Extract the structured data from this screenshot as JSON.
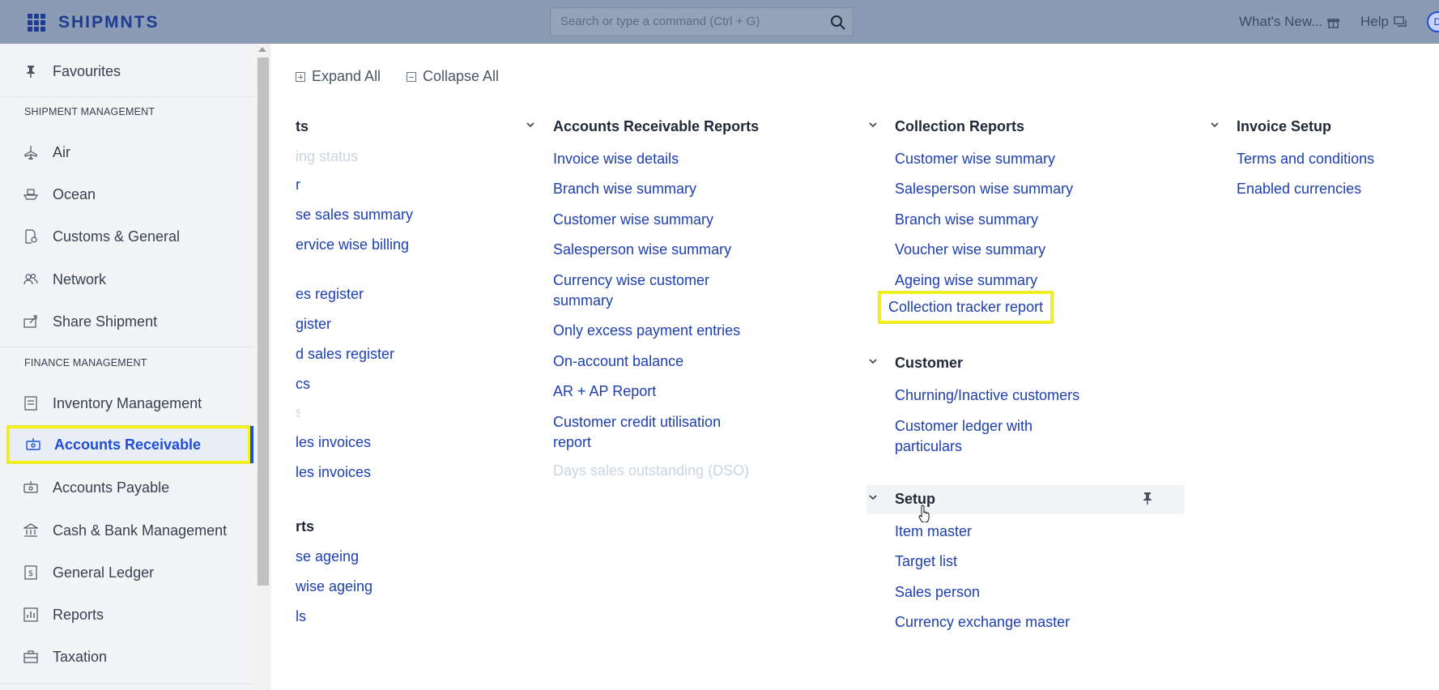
{
  "header": {
    "brand": "SHIPMNTS",
    "search_placeholder": "Search or type a command (Ctrl + G)",
    "whats_new": "What's New...",
    "help": "Help",
    "avatar_initial": "D",
    "brand_color": "#1d3b8f",
    "bar_color": "#8c9bb4"
  },
  "sidebar": {
    "favourites": "Favourites",
    "shipment_heading": "SHIPMENT MANAGEMENT",
    "shipment_items": [
      {
        "label": "Air",
        "icon": "plane-icon"
      },
      {
        "label": "Ocean",
        "icon": "ship-icon"
      },
      {
        "label": "Customs & General",
        "icon": "customs-icon"
      },
      {
        "label": "Network",
        "icon": "users-icon"
      },
      {
        "label": "Share Shipment",
        "icon": "share-icon"
      }
    ],
    "finance_heading": "FINANCE MANAGEMENT",
    "finance_items": [
      {
        "label": "Inventory Management",
        "icon": "inventory-icon"
      },
      {
        "label": "Accounts Receivable",
        "icon": "receivable-icon",
        "active": true
      },
      {
        "label": "Accounts Payable",
        "icon": "payable-icon"
      },
      {
        "label": "Cash & Bank Management",
        "icon": "bank-icon"
      },
      {
        "label": "General Ledger",
        "icon": "ledger-icon"
      },
      {
        "label": "Reports",
        "icon": "reports-icon"
      },
      {
        "label": "Taxation",
        "icon": "taxation-icon"
      }
    ],
    "active_color": "#1d4ed8",
    "highlight_color": "#f5f30e"
  },
  "toolbar": {
    "expand_all": "Expand All",
    "collapse_all": "Collapse All"
  },
  "columns": {
    "col1": {
      "title_fragment": "ts",
      "links": [
        "ing status",
        "r",
        "se sales summary",
        "ervice wise billing"
      ],
      "links2": [
        "es register",
        "gister",
        "d sales register",
        "cs",
        "s",
        "les invoices",
        "les invoices"
      ],
      "title2_fragment": "rts",
      "links3": [
        "se ageing",
        "wise ageing",
        "ls"
      ]
    },
    "ar_reports": {
      "title": "Accounts Receivable Reports",
      "links": [
        "Invoice wise details",
        "Branch wise summary",
        "Customer wise summary",
        "Salesperson wise summary",
        "Currency wise customer summary",
        "Only excess payment entries",
        "On-account balance",
        "AR + AP Report",
        "Customer credit utilisation report",
        "Days sales outstanding (DSO)"
      ]
    },
    "collection_reports": {
      "title": "Collection Reports",
      "links": [
        "Customer wise summary",
        "Salesperson wise summary",
        "Branch wise summary",
        "Voucher wise summary",
        "Ageing wise summary",
        "Collection tracker report"
      ]
    },
    "customer": {
      "title": "Customer",
      "links": [
        "Churning/Inactive customers",
        "Customer ledger with particulars"
      ]
    },
    "setup": {
      "title": "Setup",
      "links": [
        "Item master",
        "Target list",
        "Sales person",
        "Currency exchange master"
      ]
    },
    "invoice_setup": {
      "title": "Invoice Setup",
      "links": [
        "Terms and conditions",
        "Enabled currencies"
      ]
    }
  }
}
